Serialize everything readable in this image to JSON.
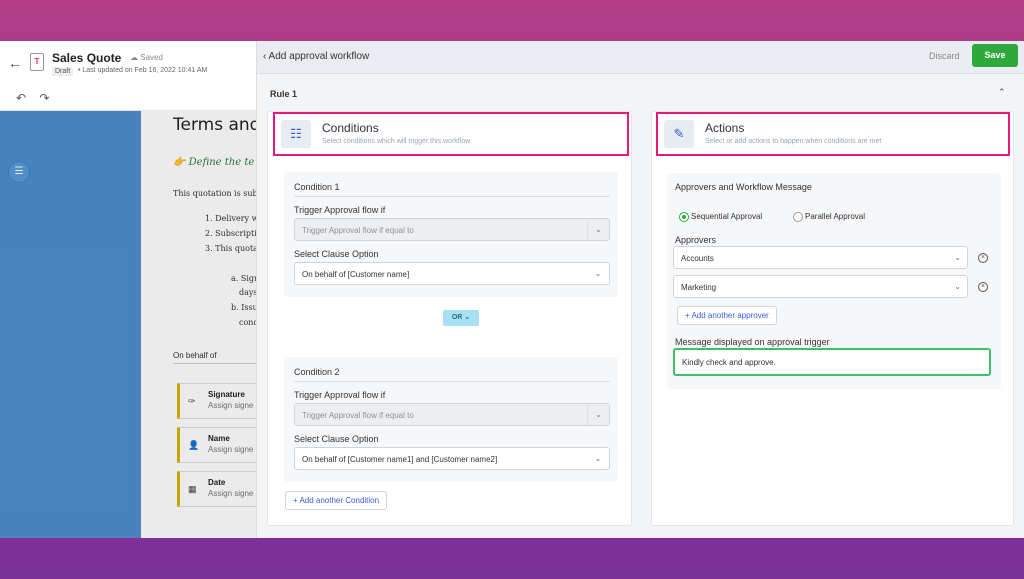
{
  "editor": {
    "doc_title": "Sales Quote",
    "saved_label": "Saved",
    "draft_badge": "Draft",
    "last_updated": "• Last updated on Feb 16, 2022 10:41 AM",
    "undo_icon": "↶",
    "redo_icon": "↷",
    "heading": "Terms and C",
    "define_text": "Define the te",
    "paragraph": "This quotation is subj",
    "list_items": [
      "1. Delivery w",
      "2. Subscriptio",
      "3. This quota"
    ],
    "sub_items": [
      "a. Sign",
      "days",
      "b. Issu",
      "cond"
    ],
    "on_behalf": "On behalf of",
    "sign_cards": [
      {
        "title": "Signature",
        "sub": "Assign signe"
      },
      {
        "title": "Name",
        "sub": "Assign signe"
      },
      {
        "title": "Date",
        "sub": "Assign signe"
      }
    ]
  },
  "modal": {
    "title": "‹ Add approval workflow",
    "discard_label": "Discard",
    "save_label": "Save",
    "rule_label": "Rule 1"
  },
  "conditions": {
    "title": "Conditions",
    "subtitle": "Select conditions which will trigger this workflow",
    "items": [
      {
        "title": "Condition 1",
        "trigger_label": "Trigger Approval flow if",
        "trigger_placeholder": "Trigger Approval flow if equal to",
        "clause_label": "Select Clause Option",
        "clause_value": "On behalf of  [Customer name]"
      },
      {
        "title": "Condition 2",
        "trigger_label": "Trigger Approval flow if",
        "trigger_placeholder": "Trigger Approval flow if equal to",
        "clause_label": "Select Clause Option",
        "clause_value": "On behalf of [Customer name1] and [Customer name2]"
      }
    ],
    "or_label": "OR",
    "add_condition_label": "+ Add another Condition"
  },
  "actions": {
    "title": "Actions",
    "subtitle": "Select or add actions to happen when conditions are met",
    "section_title": "Approvers and Workflow Message",
    "radio_sequential": "Sequential Approval",
    "radio_parallel": "Parallel Approval",
    "approvers_label": "Approvers",
    "approvers": [
      "Accounts",
      "Marketing"
    ],
    "add_approver_label": "+ Add another approver",
    "message_label": "Message displayed on approval trigger",
    "message_value": "Kindly check and approve."
  },
  "colors": {
    "accent_green": "#2ea93b",
    "highlight_pink": "#e6197a",
    "link_blue": "#3b5bdb"
  }
}
